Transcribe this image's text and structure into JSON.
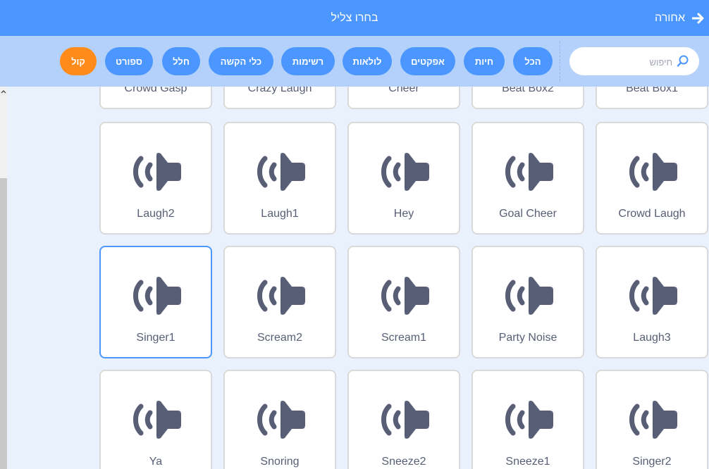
{
  "header": {
    "title": "בחרו צליל",
    "back_label": "אחורה"
  },
  "search": {
    "placeholder": "חיפוש",
    "value": ""
  },
  "categories": [
    {
      "label": "הכל",
      "active": false
    },
    {
      "label": "חיות",
      "active": false
    },
    {
      "label": "אפקטים",
      "active": false
    },
    {
      "label": "לולאות",
      "active": false
    },
    {
      "label": "רשימות",
      "active": false
    },
    {
      "label": "כלי הקשה",
      "active": false
    },
    {
      "label": "חלל",
      "active": false
    },
    {
      "label": "ספורט",
      "active": false
    },
    {
      "label": "קול",
      "active": true
    }
  ],
  "sounds": [
    [
      "Crowd Gasp",
      "Crazy Laugh",
      "Cheer",
      "Beat Box2",
      "Beat Box1"
    ],
    [
      "Laugh2",
      "Laugh1",
      "Hey",
      "Goal Cheer",
      "Crowd Laugh"
    ],
    [
      "Singer1",
      "Scream2",
      "Scream1",
      "Party Noise",
      "Laugh3"
    ],
    [
      "Ya",
      "Snoring",
      "Sneeze2",
      "Sneeze1",
      "Singer2"
    ]
  ],
  "selected_sound": "Singer1",
  "colors": {
    "header": "#4c97ff",
    "filter_bar": "#b4d1fb",
    "pill": "#4c97ff",
    "pill_active": "#ff8c1a",
    "icon": "#575e75"
  },
  "icons": {
    "back": "arrow-right-icon",
    "search": "magnifier-icon",
    "sound": "speaker-icon"
  }
}
